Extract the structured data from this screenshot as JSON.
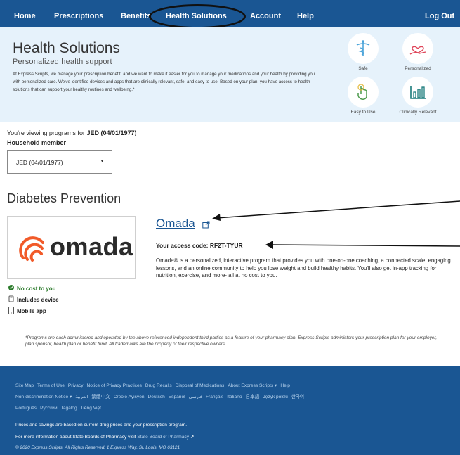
{
  "nav": {
    "items": [
      "Home",
      "Prescriptions",
      "Benefits",
      "Health Solutions",
      "Account",
      "Help"
    ],
    "logout": "Log Out"
  },
  "hero": {
    "title": "Health Solutions",
    "subtitle": "Personalized health support",
    "body": "At Express Scripts, we manage your prescription benefit, and we want to make it easier for you to manage your medications and your health by providing you with personalized care. We've identified devices and apps that are clinically relevant, safe, and easy to use. Based on your plan, you have access to health solutions that can support your healthy routines and wellbeing.*",
    "features": [
      {
        "label": "Safe",
        "icon": "caduceus-icon"
      },
      {
        "label": "Personalized",
        "icon": "heart-hand-icon"
      },
      {
        "label": "Easy to Use",
        "icon": "touch-hand-icon"
      },
      {
        "label": "Clinically Relevant",
        "icon": "bar-chart-icon"
      }
    ]
  },
  "viewing": {
    "prefix": "You're viewing programs for",
    "member": "JED (04/01/1977)"
  },
  "household": {
    "label": "Household member",
    "selected": "JED (04/01/1977)"
  },
  "program": {
    "section_title": "Diabetes Prevention",
    "logo_text": "omada",
    "name": "Omada",
    "access_code_label": "Your access code: RF2T-TYUR",
    "description": "Omada® is a personalized, interactive program that provides you with one-on-one coaching, a connected scale, engaging lessons, and an online community to help you lose weight and build healthy habits. You'll also get in-app tracking for nutrition, exercise, and more- all at no cost to you.",
    "perks": [
      "No cost to you",
      "Includes device",
      "Mobile app"
    ]
  },
  "disclaimer": "*Programs are each administered and operated by the above referenced independent third parties as a feature of your pharmacy plan. Express Scripts administers your prescription plan for your employer, plan sponsor, health plan or benefit fund. All trademarks are the property of their respective owners.",
  "footer": {
    "links": [
      "Site Map",
      "Terms of Use",
      "Privacy",
      "Notice of Privacy Practices",
      "Drug Recalls",
      "Disposal of Medications",
      "About Express Scripts ▾",
      "Help",
      "Non-discrimination Notice ▾",
      "العربية",
      "繁體中文",
      "Creole Ayisyen",
      "Deutsch",
      "Español",
      "فارسی",
      "Français",
      "Italiano",
      "日本語",
      "Język polski",
      "한국어",
      "Português",
      "Русский",
      "Tagalog",
      "Tiếng Việt"
    ],
    "prices_note": "Prices and savings are based on current drug prices and your prescription program.",
    "boards_prefix": "For more information about State Boards of Pharmacy visit",
    "boards_link": "State Board of Pharmacy",
    "copyright": "© 2020 Express Scripts. All Rights Reserved. 1 Express Way, St. Louis, MO 63121"
  },
  "colors": {
    "brand_blue": "#1a5693",
    "hero_bg": "#e6f2fb",
    "omada_orange": "#f15a29",
    "success_green": "#2a7a2a"
  }
}
